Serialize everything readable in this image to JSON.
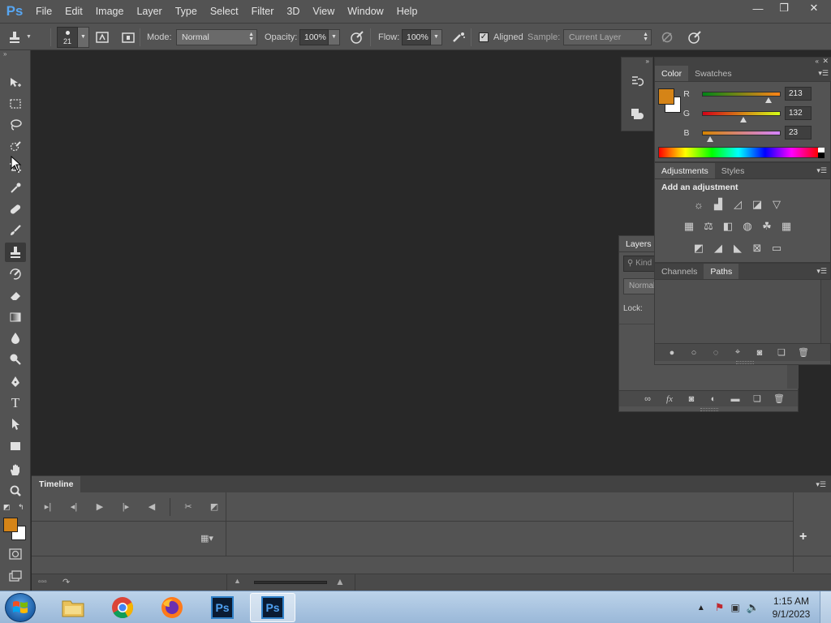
{
  "app": {
    "logo": "Ps"
  },
  "menu": [
    "File",
    "Edit",
    "Image",
    "Layer",
    "Type",
    "Select",
    "Filter",
    "3D",
    "View",
    "Window",
    "Help"
  ],
  "window_controls": {
    "minimize": "—",
    "restore": "❐",
    "close": "✕"
  },
  "options": {
    "brush_size": "21",
    "mode_label": "Mode:",
    "mode_value": "Normal",
    "opacity_label": "Opacity:",
    "opacity_value": "100%",
    "flow_label": "Flow:",
    "flow_value": "100%",
    "aligned_label": "Aligned",
    "sample_label": "Sample:",
    "sample_value": "Current Layer"
  },
  "tools": [
    "move-icon",
    "marquee-icon",
    "lasso-icon",
    "quick-select-icon",
    "crop-icon",
    "eyedropper-icon",
    "healing-brush-icon",
    "brush-icon",
    "clone-stamp-icon",
    "history-brush-icon",
    "eraser-icon",
    "gradient-icon",
    "blur-icon",
    "dodge-icon",
    "pen-icon",
    "type-icon",
    "path-select-icon",
    "rectangle-icon",
    "hand-icon",
    "zoom-icon"
  ],
  "colors": {
    "foreground": "#d58417",
    "background": "#ffffff"
  },
  "color_panel": {
    "tabs": [
      "Color",
      "Swatches"
    ],
    "r_label": "R",
    "r_value": "213",
    "r_num": 213,
    "g_label": "G",
    "g_value": "132",
    "g_num": 132,
    "b_label": "B",
    "b_value": "23",
    "b_num": 23
  },
  "adjustments_panel": {
    "tabs": [
      "Adjustments",
      "Styles"
    ],
    "heading": "Add an adjustment"
  },
  "layers_panel": {
    "tab": "Layers",
    "kind_placeholder": "Kind",
    "blend_value": "Normal",
    "lock_label": "Lock:"
  },
  "paths_panel": {
    "tabs": [
      "Channels",
      "Paths"
    ]
  },
  "timeline": {
    "tab": "Timeline"
  },
  "taskbar": {
    "apps": [
      "explorer",
      "chrome",
      "firefox",
      "photoshop",
      "photoshop"
    ],
    "ps_label": "Ps",
    "time": "1:15 AM",
    "date": "9/1/2023"
  }
}
